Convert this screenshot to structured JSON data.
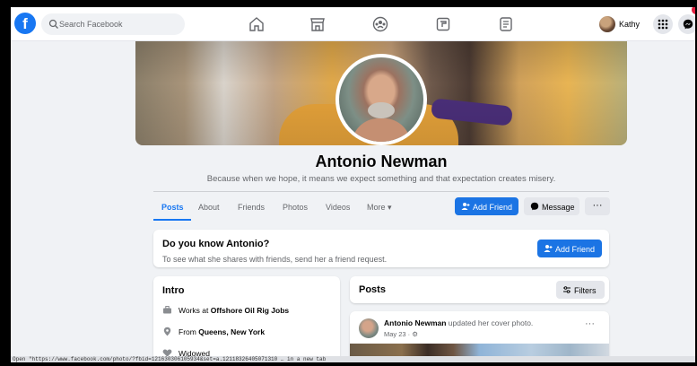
{
  "topbar": {
    "search_placeholder": "Search Facebook",
    "user_name": "Kathy",
    "nav_icons": [
      "home-icon",
      "marketplace-icon",
      "groups-icon",
      "gaming-icon",
      "pages-icon"
    ]
  },
  "profile": {
    "name": "Antonio Newman",
    "bio": "Because when we hope, it means we expect something and that expectation creates misery."
  },
  "tabs": [
    {
      "label": "Posts"
    },
    {
      "label": "About"
    },
    {
      "label": "Friends"
    },
    {
      "label": "Photos"
    },
    {
      "label": "Videos"
    },
    {
      "label": "More ▾"
    }
  ],
  "actions": {
    "add_friend": "Add Friend",
    "message": "Message",
    "more": "···"
  },
  "know": {
    "title": "Do you know Antonio?",
    "subtitle": "To see what she shares with friends, send her a friend request.",
    "button": "Add Friend"
  },
  "intro": {
    "title": "Intro",
    "works_prefix": "Works at ",
    "works_place": "Offshore Oil Rig Jobs",
    "from_prefix": "From ",
    "from_place": "Queens, New York",
    "status": "Widowed"
  },
  "posts": {
    "title": "Posts",
    "filters": "Filters",
    "post": {
      "author": "Antonio Newman",
      "action": " updated her cover photo.",
      "date": "May 23 · ⚙"
    }
  },
  "statusbar": {
    "text": "Open \"https://www.facebook.com/photo/?fbid=121630306105934&set=a.12118326405071310 … in a new tab"
  },
  "colors": {
    "brand": "#1877f2",
    "notification": "#e41e3f"
  }
}
